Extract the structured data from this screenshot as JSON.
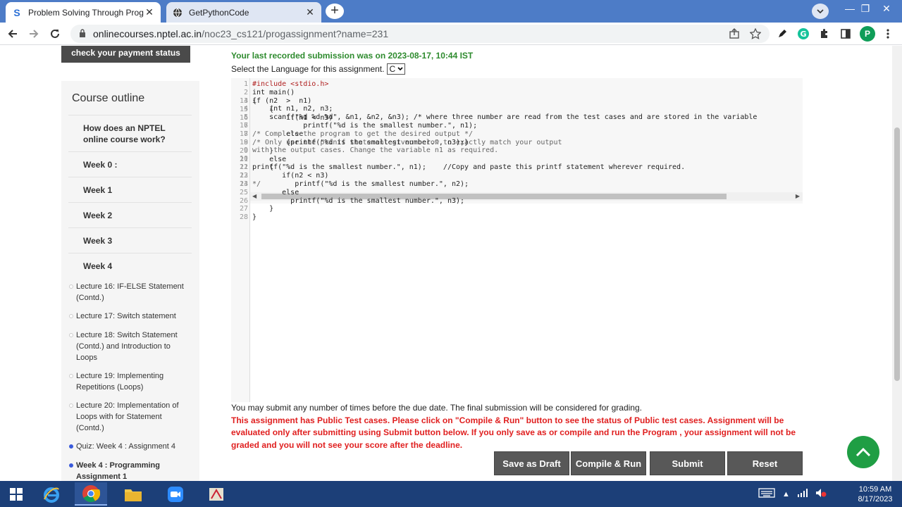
{
  "browser": {
    "tabs": [
      {
        "title": "Problem Solving Through Progra",
        "favicon": "S",
        "active": true
      },
      {
        "title": "GetPythonCode",
        "favicon": "globe-icon",
        "active": false
      }
    ],
    "url_host": "onlinecourses.nptel.ac.in",
    "url_path": "/noc23_cs121/progassignment?name=231",
    "profile_initial": "P"
  },
  "header": {
    "payment_button": "check your payment status"
  },
  "sidebar": {
    "title": "Course outline",
    "items": [
      {
        "label": "How does an NPTEL online course work?"
      },
      {
        "label": "Week 0 :"
      },
      {
        "label": "Week 1"
      },
      {
        "label": "Week 2"
      },
      {
        "label": "Week 3"
      },
      {
        "label": "Week 4"
      }
    ],
    "week4_items": [
      {
        "label": "Lecture 16: IF-ELSE Statement (Contd.)",
        "current": false
      },
      {
        "label": "Lecture 17: Switch statement",
        "current": false
      },
      {
        "label": "Lecture 18: Switch Statement (Contd.) and Introduction to Loops",
        "current": false
      },
      {
        "label": "Lecture 19: Implementing Repetitions (Loops)",
        "current": false
      },
      {
        "label": "Lecture 20: Implementation of Loops with for Statement (Contd.)",
        "current": false
      },
      {
        "label": "Quiz: Week 4 : Assignment 4",
        "current": true
      },
      {
        "label": "Week 4 : Programming Assignment 1",
        "current": true
      }
    ]
  },
  "main": {
    "last_submission": "Your last recorded submission was on 2023-08-17, 10:44 IST",
    "language_label": "Select the Language for this assignment.",
    "language_value": "C",
    "code_top": [
      {
        "n": "1",
        "text": "#include <stdio.h>"
      },
      {
        "n": "2",
        "text": "int main()"
      },
      {
        "n": "3",
        "text": "{"
      },
      {
        "n": "4",
        "text": "    int n1, n2, n3;"
      },
      {
        "n": "5",
        "text": "    scanf(\"%d %d %d\", &n1, &n2, &n3); /* where three number are read from the test cases and are stored in the variable"
      },
      {
        "n": "6",
        "text": ""
      },
      {
        "n": "7",
        "text": "/* Complete the program to get the desired output */"
      },
      {
        "n": "8",
        "text": "/* Only use the printf statement given below to exactly match your output"
      },
      {
        "n": "9",
        "text": "with the output cases. Change the variable n1 as required."
      },
      {
        "n": "10",
        "text": ""
      },
      {
        "n": "11",
        "text": "printf(\"%d is the smallest number.\", n1);    //Copy and paste this printf statement wherever required."
      },
      {
        "n": "12",
        "text": ""
      },
      {
        "n": "13",
        "text": "*/"
      }
    ],
    "code_bottom": [
      {
        "n": "14",
        "text": "if (n2  >  n1)"
      },
      {
        "n": "15",
        "text": "    {"
      },
      {
        "n": "16",
        "text": "        if(n1 < n3)"
      },
      {
        "n": "17",
        "text": "            printf(\"%d is the smallest number.\", n1);"
      },
      {
        "n": "18",
        "text": "        else"
      },
      {
        "n": "19",
        "text": "        {printf(\"%d is the smallest number.\", n3);}"
      },
      {
        "n": "20",
        "text": "    }"
      },
      {
        "n": "21",
        "text": "    else"
      },
      {
        "n": "22",
        "text": "    {"
      },
      {
        "n": "23",
        "text": "       if(n2 < n3)"
      },
      {
        "n": "24",
        "text": "          printf(\"%d is the smallest number.\", n2);"
      },
      {
        "n": "25",
        "text": "       else"
      },
      {
        "n": "26",
        "text": "         printf(\"%d is the smallest number.\", n3);"
      },
      {
        "n": "27",
        "text": "    }"
      },
      {
        "n": "28",
        "text": "}"
      }
    ],
    "note_info": "You may submit any number of times before the due date. The final submission will be considered for grading.",
    "note_warning": "This assignment has Public Test cases. Please click on \"Compile & Run\" button to see the status of Public test cases. Assignment will be evaluated only after submitting using Submit button below. If you only save as or compile and run the Program , your assignment will not be graded and you will not see your score after the deadline.",
    "buttons": {
      "save_draft": "Save as Draft",
      "compile_run": "Compile & Run",
      "submit": "Submit",
      "reset": "Reset"
    }
  },
  "taskbar": {
    "time": "10:59 AM",
    "date": "8/17/2023"
  },
  "colors": {
    "tabbar": "#4d7cc7",
    "success_text": "#2e8b2e",
    "warning_text": "#e02020",
    "button_bg": "#585858",
    "fab": "#1f9e44",
    "taskbar": "#1c3f78"
  }
}
